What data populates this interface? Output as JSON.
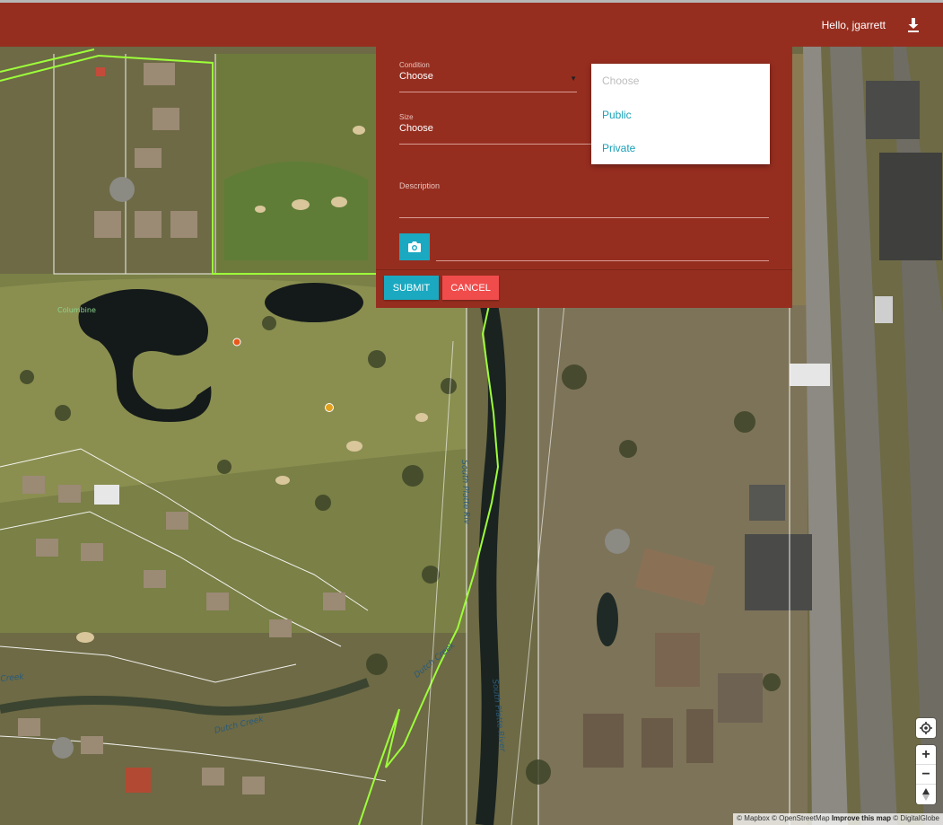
{
  "header": {
    "greeting": "Hello, jgarrett",
    "download_icon": "download-icon"
  },
  "form": {
    "condition_label": "Condition",
    "condition_value": "Choose",
    "size_label": "Size",
    "size_value": "Choose",
    "description_label": "Description",
    "photo_icon": "camera-icon",
    "submit_label": "SUBMIT",
    "cancel_label": "CANCEL"
  },
  "dropdown": {
    "placeholder": "Choose",
    "options": [
      "Public",
      "Private"
    ]
  },
  "map": {
    "labels": {
      "dutch_creek_1": "Dutch Creek",
      "dutch_creek_2": "Dutch Creek",
      "creek_left": "Creek",
      "south_platte_1": "South Platte Riv",
      "south_platte_2": "South Platte River",
      "columbine": "Columbine"
    },
    "controls": {
      "locate_icon": "locate-icon",
      "zoom_in": "+",
      "zoom_out": "−",
      "compass_icon": "compass-icon"
    },
    "attribution": {
      "mapbox": "© Mapbox",
      "osm": "© OpenStreetMap",
      "improve": "Improve this map",
      "digitalglobe": "© DigitalGlobe"
    }
  },
  "colors": {
    "header_bg": "#962e20",
    "accent": "#1aa9c0",
    "cancel": "#f04c4c",
    "boundary_line": "#9dff3a"
  }
}
